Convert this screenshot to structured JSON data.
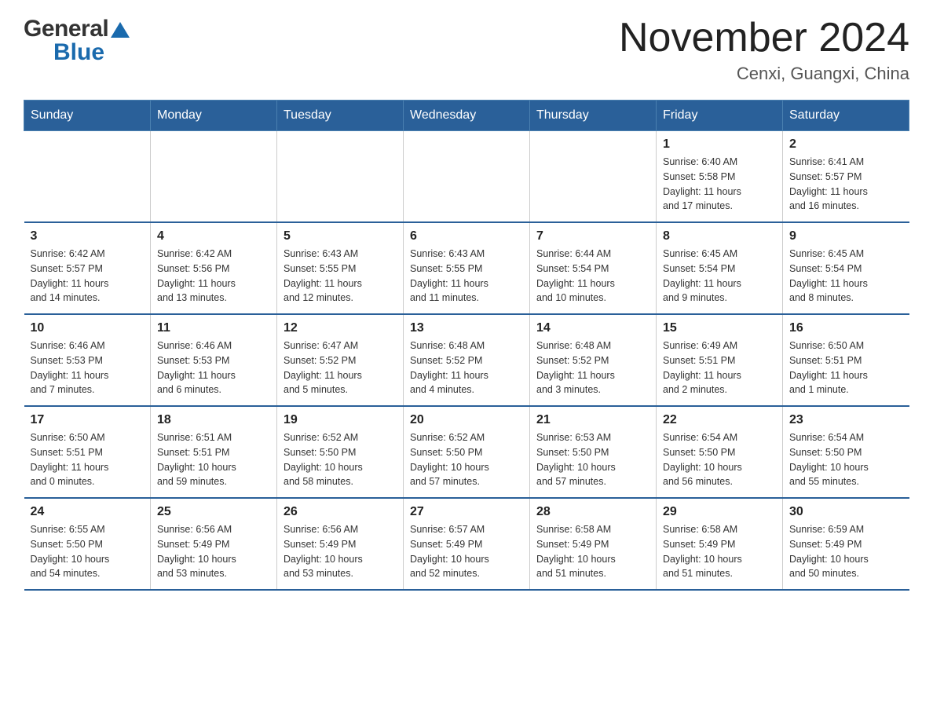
{
  "header": {
    "logo_general": "General",
    "logo_blue": "Blue",
    "month_title": "November 2024",
    "location": "Cenxi, Guangxi, China"
  },
  "days_of_week": [
    "Sunday",
    "Monday",
    "Tuesday",
    "Wednesday",
    "Thursday",
    "Friday",
    "Saturday"
  ],
  "weeks": [
    [
      {
        "day": "",
        "info": ""
      },
      {
        "day": "",
        "info": ""
      },
      {
        "day": "",
        "info": ""
      },
      {
        "day": "",
        "info": ""
      },
      {
        "day": "",
        "info": ""
      },
      {
        "day": "1",
        "info": "Sunrise: 6:40 AM\nSunset: 5:58 PM\nDaylight: 11 hours\nand 17 minutes."
      },
      {
        "day": "2",
        "info": "Sunrise: 6:41 AM\nSunset: 5:57 PM\nDaylight: 11 hours\nand 16 minutes."
      }
    ],
    [
      {
        "day": "3",
        "info": "Sunrise: 6:42 AM\nSunset: 5:57 PM\nDaylight: 11 hours\nand 14 minutes."
      },
      {
        "day": "4",
        "info": "Sunrise: 6:42 AM\nSunset: 5:56 PM\nDaylight: 11 hours\nand 13 minutes."
      },
      {
        "day": "5",
        "info": "Sunrise: 6:43 AM\nSunset: 5:55 PM\nDaylight: 11 hours\nand 12 minutes."
      },
      {
        "day": "6",
        "info": "Sunrise: 6:43 AM\nSunset: 5:55 PM\nDaylight: 11 hours\nand 11 minutes."
      },
      {
        "day": "7",
        "info": "Sunrise: 6:44 AM\nSunset: 5:54 PM\nDaylight: 11 hours\nand 10 minutes."
      },
      {
        "day": "8",
        "info": "Sunrise: 6:45 AM\nSunset: 5:54 PM\nDaylight: 11 hours\nand 9 minutes."
      },
      {
        "day": "9",
        "info": "Sunrise: 6:45 AM\nSunset: 5:54 PM\nDaylight: 11 hours\nand 8 minutes."
      }
    ],
    [
      {
        "day": "10",
        "info": "Sunrise: 6:46 AM\nSunset: 5:53 PM\nDaylight: 11 hours\nand 7 minutes."
      },
      {
        "day": "11",
        "info": "Sunrise: 6:46 AM\nSunset: 5:53 PM\nDaylight: 11 hours\nand 6 minutes."
      },
      {
        "day": "12",
        "info": "Sunrise: 6:47 AM\nSunset: 5:52 PM\nDaylight: 11 hours\nand 5 minutes."
      },
      {
        "day": "13",
        "info": "Sunrise: 6:48 AM\nSunset: 5:52 PM\nDaylight: 11 hours\nand 4 minutes."
      },
      {
        "day": "14",
        "info": "Sunrise: 6:48 AM\nSunset: 5:52 PM\nDaylight: 11 hours\nand 3 minutes."
      },
      {
        "day": "15",
        "info": "Sunrise: 6:49 AM\nSunset: 5:51 PM\nDaylight: 11 hours\nand 2 minutes."
      },
      {
        "day": "16",
        "info": "Sunrise: 6:50 AM\nSunset: 5:51 PM\nDaylight: 11 hours\nand 1 minute."
      }
    ],
    [
      {
        "day": "17",
        "info": "Sunrise: 6:50 AM\nSunset: 5:51 PM\nDaylight: 11 hours\nand 0 minutes."
      },
      {
        "day": "18",
        "info": "Sunrise: 6:51 AM\nSunset: 5:51 PM\nDaylight: 10 hours\nand 59 minutes."
      },
      {
        "day": "19",
        "info": "Sunrise: 6:52 AM\nSunset: 5:50 PM\nDaylight: 10 hours\nand 58 minutes."
      },
      {
        "day": "20",
        "info": "Sunrise: 6:52 AM\nSunset: 5:50 PM\nDaylight: 10 hours\nand 57 minutes."
      },
      {
        "day": "21",
        "info": "Sunrise: 6:53 AM\nSunset: 5:50 PM\nDaylight: 10 hours\nand 57 minutes."
      },
      {
        "day": "22",
        "info": "Sunrise: 6:54 AM\nSunset: 5:50 PM\nDaylight: 10 hours\nand 56 minutes."
      },
      {
        "day": "23",
        "info": "Sunrise: 6:54 AM\nSunset: 5:50 PM\nDaylight: 10 hours\nand 55 minutes."
      }
    ],
    [
      {
        "day": "24",
        "info": "Sunrise: 6:55 AM\nSunset: 5:50 PM\nDaylight: 10 hours\nand 54 minutes."
      },
      {
        "day": "25",
        "info": "Sunrise: 6:56 AM\nSunset: 5:49 PM\nDaylight: 10 hours\nand 53 minutes."
      },
      {
        "day": "26",
        "info": "Sunrise: 6:56 AM\nSunset: 5:49 PM\nDaylight: 10 hours\nand 53 minutes."
      },
      {
        "day": "27",
        "info": "Sunrise: 6:57 AM\nSunset: 5:49 PM\nDaylight: 10 hours\nand 52 minutes."
      },
      {
        "day": "28",
        "info": "Sunrise: 6:58 AM\nSunset: 5:49 PM\nDaylight: 10 hours\nand 51 minutes."
      },
      {
        "day": "29",
        "info": "Sunrise: 6:58 AM\nSunset: 5:49 PM\nDaylight: 10 hours\nand 51 minutes."
      },
      {
        "day": "30",
        "info": "Sunrise: 6:59 AM\nSunset: 5:49 PM\nDaylight: 10 hours\nand 50 minutes."
      }
    ]
  ]
}
